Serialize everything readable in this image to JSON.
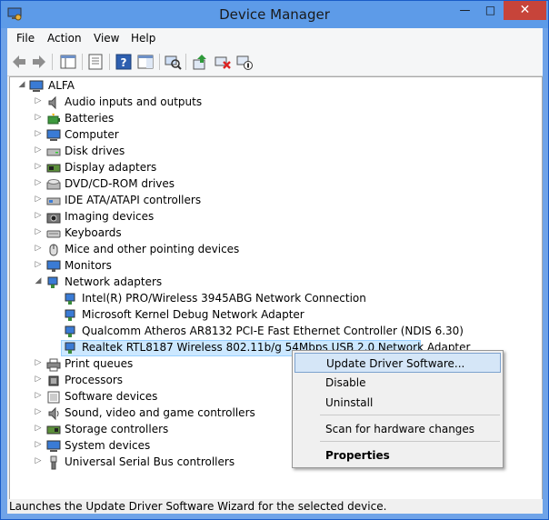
{
  "window": {
    "title": "Device Manager",
    "min_symbol": "—",
    "max_symbol": "□",
    "close_symbol": "✕"
  },
  "menu": [
    "File",
    "Action",
    "View",
    "Help"
  ],
  "tree": {
    "root": "ALFA",
    "categories": [
      {
        "label": "Audio inputs and outputs",
        "icon": "speaker-icon"
      },
      {
        "label": "Batteries",
        "icon": "battery-icon"
      },
      {
        "label": "Computer",
        "icon": "computer-icon"
      },
      {
        "label": "Disk drives",
        "icon": "disk-drive-icon"
      },
      {
        "label": "Display adapters",
        "icon": "display-adapter-icon"
      },
      {
        "label": "DVD/CD-ROM drives",
        "icon": "dvd-drive-icon"
      },
      {
        "label": "IDE ATA/ATAPI controllers",
        "icon": "ide-controller-icon"
      },
      {
        "label": "Imaging devices",
        "icon": "camera-icon"
      },
      {
        "label": "Keyboards",
        "icon": "keyboard-icon"
      },
      {
        "label": "Mice and other pointing devices",
        "icon": "mouse-icon"
      },
      {
        "label": "Monitors",
        "icon": "monitor-icon"
      },
      {
        "label": "Network adapters",
        "icon": "network-adapter-icon",
        "expanded": true
      },
      {
        "label": "Print queues",
        "icon": "printer-icon"
      },
      {
        "label": "Processors",
        "icon": "processor-icon"
      },
      {
        "label": "Software devices",
        "icon": "software-device-icon"
      },
      {
        "label": "Sound, video and game controllers",
        "icon": "sound-icon"
      },
      {
        "label": "Storage controllers",
        "icon": "storage-controller-icon"
      },
      {
        "label": "System devices",
        "icon": "system-device-icon"
      },
      {
        "label": "Universal Serial Bus controllers",
        "icon": "usb-icon"
      }
    ],
    "network_children": [
      "Intel(R) PRO/Wireless 3945ABG Network Connection",
      "Microsoft Kernel Debug Network Adapter",
      "Qualcomm Atheros AR8132 PCI-E Fast Ethernet Controller (NDIS 6.30)",
      "Realtek RTL8187 Wireless 802.11b/g 54Mbps USB 2.0 Network Adapter"
    ],
    "selected_child": 3
  },
  "context_menu": {
    "items": [
      "Update Driver Software...",
      "Disable",
      "Uninstall",
      "Scan for hardware changes",
      "Properties"
    ],
    "highlighted": 0
  },
  "status": "Launches the Update Driver Software Wizard for the selected device.",
  "colors": {
    "title_bar": "#5d9be8",
    "close_button": "#c7443a",
    "selection": "#cce8ff",
    "menu_highlight": "#d5e6f7"
  }
}
